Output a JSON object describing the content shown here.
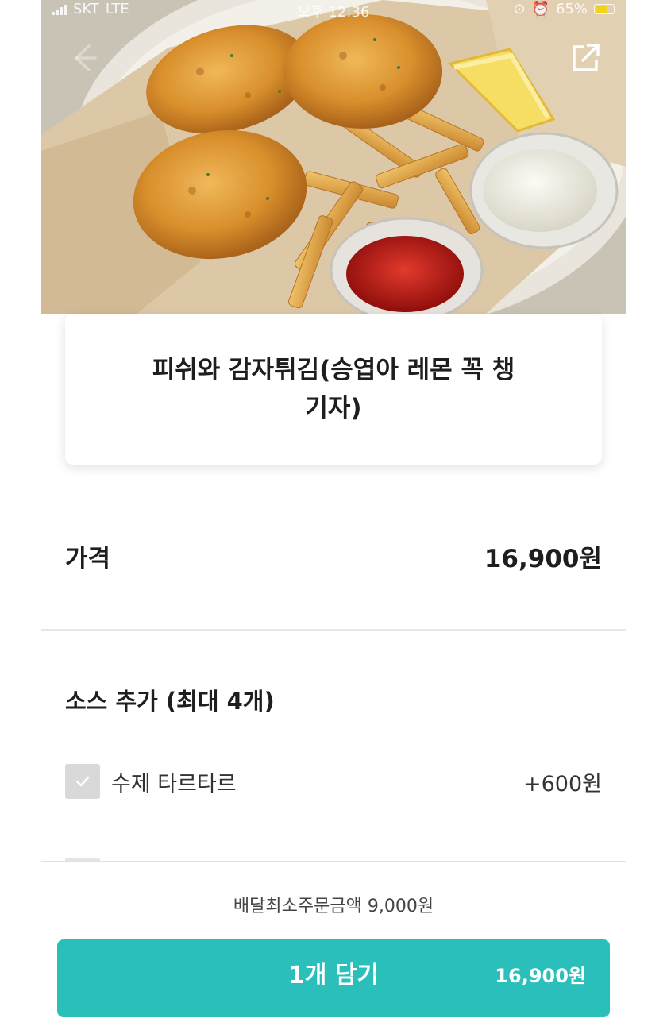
{
  "status_bar": {
    "carrier": "SKT",
    "network": "LTE",
    "time": "오후 12:36",
    "battery": "65%",
    "battery_level": 0.65
  },
  "header": {
    "back_icon": "arrow-left-icon",
    "share_icon": "share-icon"
  },
  "menu_item": {
    "title": "피쉬와 감자튀김(승엽아 레몬 꼭 챙기자)"
  },
  "price_row": {
    "label": "가격",
    "value": "16,900원"
  },
  "sauce_section": {
    "title": "소스 추가 (최대 4개)",
    "options": [
      {
        "label": "수제 타르타르",
        "price": "+600원",
        "checked": false
      }
    ]
  },
  "footer": {
    "min_order": "배달최소주문금액 9,000원",
    "cart_button_label": "1개 담기",
    "cart_button_total": "16,900원"
  },
  "colors": {
    "accent": "#2bbfbb",
    "checkbox_bg": "#d9d9d9",
    "divider": "#e7e7e7"
  }
}
